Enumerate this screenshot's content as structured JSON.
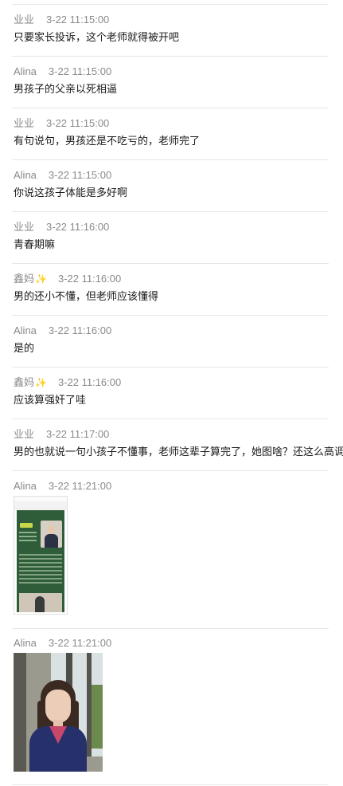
{
  "comments": [
    {
      "author": "业业",
      "sparkle": "",
      "time": "3-22 11:15:00",
      "text": "只要家长投诉，这个老师就得被开吧"
    },
    {
      "author": "Alina",
      "sparkle": "",
      "time": "3-22 11:15:00",
      "text": "男孩子的父亲以死相逼"
    },
    {
      "author": "业业",
      "sparkle": "",
      "time": "3-22 11:15:00",
      "text": "有句说句，男孩还是不吃亏的，老师完了"
    },
    {
      "author": "Alina",
      "sparkle": "",
      "time": "3-22 11:15:00",
      "text": "你说这孩子体能是多好啊"
    },
    {
      "author": "业业",
      "sparkle": "",
      "time": "3-22 11:16:00",
      "text": "青春期嘛"
    },
    {
      "author": "鑫妈",
      "sparkle": "✨",
      "time": "3-22 11:16:00",
      "text": "男的还小不懂，但老师应该懂得"
    },
    {
      "author": "Alina",
      "sparkle": "",
      "time": "3-22 11:16:00",
      "text": "是的"
    },
    {
      "author": "鑫妈",
      "sparkle": "✨",
      "time": "3-22 11:16:00",
      "text": "应该算强奸了哇"
    },
    {
      "author": "业业",
      "sparkle": "",
      "time": "3-22 11:17:00",
      "text": "男的也就说一句小孩子不懂事，老师这辈子算完了，她图啥？还这么高调"
    },
    {
      "author": "Alina",
      "sparkle": "",
      "time": "3-22 11:21:00",
      "text": ""
    },
    {
      "author": "Alina",
      "sparkle": "",
      "time": "3-22 11:21:00",
      "text": ""
    }
  ]
}
